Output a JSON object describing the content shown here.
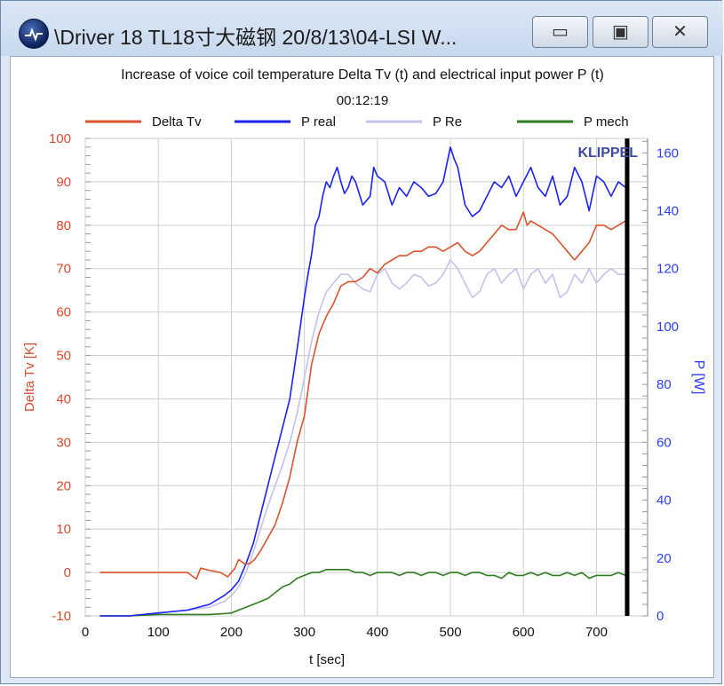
{
  "window": {
    "title": "\\Driver 18 TL18寸大磁钢 20/8/13\\04-LSI W...",
    "controls": {
      "minimize": "▭",
      "maximize": "▣",
      "close": "✕"
    }
  },
  "chart_data": {
    "type": "line",
    "title": "Increase of voice coil temperature Delta Tv (t) and electrical input power P (t)",
    "subtitle": "00:12:19",
    "brand": "KLIPPEL",
    "xlabel": "t [sec]",
    "ylabel_left": "Delta Tv [K]",
    "ylabel_right": "P [W]",
    "xlim": [
      0,
      770
    ],
    "ylim_left": [
      -10,
      100
    ],
    "ylim_right": [
      0,
      165
    ],
    "xticks": [
      0,
      100,
      200,
      300,
      400,
      500,
      600,
      700
    ],
    "yticks_left": [
      -10,
      0,
      10,
      20,
      30,
      40,
      50,
      60,
      70,
      80,
      90,
      100
    ],
    "yticks_right": [
      0,
      20,
      40,
      60,
      80,
      100,
      120,
      140,
      160
    ],
    "grid": true,
    "legend_position": "top",
    "cursor_x": 742,
    "colors": {
      "left_axis": "#d84a2e",
      "right_axis": "#2a3cf0"
    },
    "series": [
      {
        "name": "Delta Tv",
        "axis": "left",
        "color": "#d9532c",
        "x": [
          20,
          140,
          148,
          152,
          158,
          170,
          185,
          195,
          205,
          210,
          218,
          225,
          232,
          240,
          250,
          260,
          270,
          280,
          290,
          300,
          310,
          320,
          330,
          340,
          350,
          360,
          370,
          380,
          390,
          400,
          410,
          420,
          430,
          440,
          450,
          460,
          470,
          480,
          490,
          500,
          510,
          520,
          530,
          540,
          550,
          560,
          570,
          580,
          590,
          600,
          605,
          610,
          620,
          630,
          640,
          650,
          660,
          670,
          680,
          690,
          700,
          710,
          720,
          730,
          740
        ],
        "values": [
          0,
          0,
          -1,
          -1.5,
          1,
          0.5,
          0,
          -1,
          1,
          3,
          2,
          2,
          3,
          5,
          8,
          11,
          16,
          22,
          30,
          36,
          48,
          55,
          59,
          62,
          66,
          67,
          67,
          68,
          70,
          69,
          71,
          72,
          73,
          73,
          74,
          74,
          75,
          75,
          74,
          75,
          76,
          74,
          73,
          74,
          76,
          78,
          80,
          79,
          79,
          83,
          80,
          81,
          80,
          79,
          78,
          76,
          74,
          72,
          74,
          76,
          80,
          80,
          79,
          80,
          81
        ]
      },
      {
        "name": "P real",
        "axis": "right",
        "color": "#1a22ee",
        "x": [
          20,
          60,
          100,
          140,
          170,
          190,
          200,
          210,
          220,
          230,
          240,
          250,
          260,
          270,
          280,
          290,
          300,
          305,
          310,
          315,
          320,
          325,
          330,
          335,
          340,
          345,
          350,
          355,
          360,
          365,
          370,
          380,
          390,
          395,
          400,
          410,
          420,
          430,
          440,
          450,
          460,
          470,
          480,
          490,
          500,
          505,
          510,
          520,
          530,
          540,
          550,
          560,
          570,
          580,
          590,
          600,
          610,
          620,
          630,
          640,
          650,
          660,
          670,
          680,
          690,
          700,
          710,
          720,
          730,
          740
        ],
        "values": [
          0,
          0,
          1,
          2,
          4,
          7,
          9,
          12,
          18,
          25,
          35,
          45,
          55,
          65,
          75,
          92,
          110,
          118,
          125,
          135,
          138,
          145,
          150,
          148,
          152,
          155,
          150,
          146,
          148,
          152,
          150,
          142,
          145,
          155,
          152,
          150,
          142,
          148,
          145,
          150,
          148,
          145,
          146,
          150,
          162,
          158,
          155,
          142,
          138,
          140,
          145,
          150,
          148,
          152,
          145,
          150,
          155,
          148,
          145,
          152,
          142,
          145,
          155,
          150,
          140,
          152,
          150,
          145,
          150,
          148
        ]
      },
      {
        "name": "P Re",
        "axis": "right",
        "color": "#c2c2ec",
        "x": [
          20,
          60,
          100,
          140,
          170,
          190,
          200,
          210,
          220,
          230,
          240,
          250,
          260,
          270,
          280,
          290,
          300,
          310,
          320,
          330,
          340,
          350,
          360,
          370,
          380,
          390,
          400,
          410,
          420,
          430,
          440,
          450,
          460,
          470,
          480,
          490,
          500,
          510,
          520,
          530,
          540,
          550,
          560,
          570,
          580,
          590,
          600,
          610,
          620,
          630,
          640,
          650,
          660,
          670,
          680,
          690,
          700,
          710,
          720,
          730,
          740
        ],
        "values": [
          0,
          0,
          1,
          2,
          3,
          5,
          7,
          10,
          15,
          22,
          30,
          38,
          45,
          52,
          60,
          70,
          82,
          95,
          105,
          112,
          115,
          118,
          118,
          115,
          113,
          112,
          118,
          120,
          115,
          113,
          115,
          118,
          117,
          114,
          115,
          118,
          123,
          120,
          115,
          110,
          112,
          118,
          120,
          115,
          118,
          120,
          113,
          118,
          120,
          115,
          118,
          110,
          112,
          118,
          115,
          120,
          115,
          118,
          120,
          118,
          118
        ]
      },
      {
        "name": "P mech",
        "axis": "right",
        "color": "#2e7d1e",
        "x": [
          20,
          60,
          100,
          140,
          170,
          190,
          200,
          210,
          220,
          230,
          240,
          250,
          260,
          270,
          280,
          290,
          300,
          310,
          320,
          330,
          340,
          350,
          360,
          370,
          380,
          390,
          400,
          410,
          420,
          430,
          440,
          450,
          460,
          470,
          480,
          490,
          500,
          510,
          520,
          530,
          540,
          550,
          560,
          570,
          580,
          590,
          600,
          610,
          620,
          630,
          640,
          650,
          660,
          670,
          680,
          690,
          700,
          710,
          720,
          730,
          740
        ],
        "values": [
          0,
          0,
          0.5,
          0.5,
          0.5,
          0.8,
          1,
          2,
          3,
          4,
          5,
          6,
          8,
          10,
          11,
          13,
          14,
          15,
          15,
          16,
          16,
          16,
          16,
          15,
          15,
          14,
          15,
          15,
          15,
          14,
          15,
          15,
          14,
          15,
          15,
          14,
          15,
          15,
          14,
          15,
          15,
          14,
          14,
          13,
          15,
          14,
          14,
          15,
          14,
          15,
          14,
          14,
          15,
          14,
          15,
          13,
          14,
          14,
          14,
          15,
          14
        ]
      }
    ]
  }
}
